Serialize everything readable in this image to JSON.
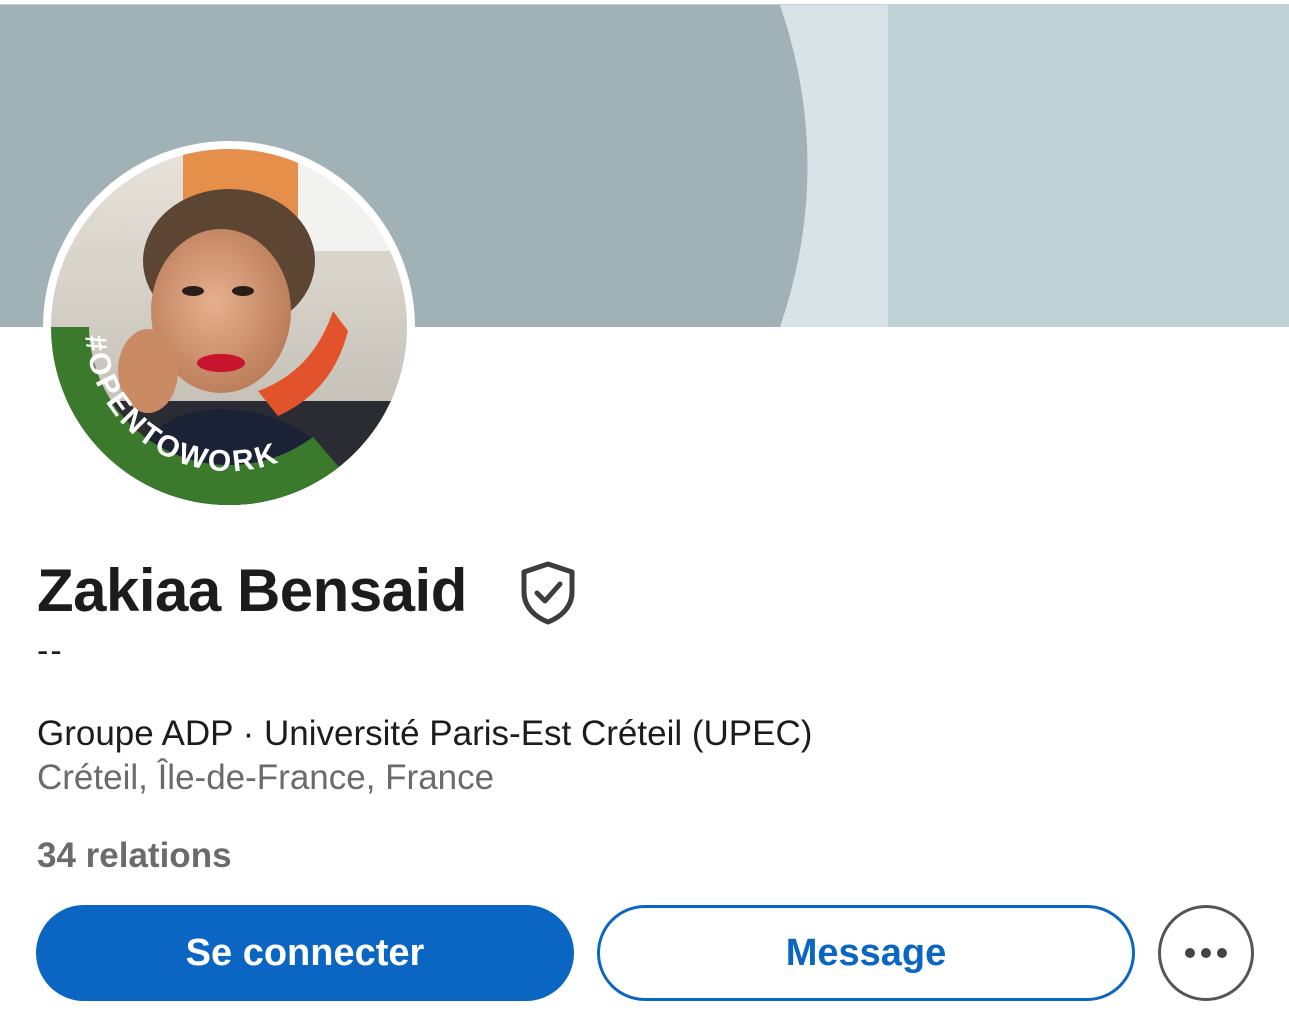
{
  "profile": {
    "name": "Zakiaa Bensaid",
    "headline": "--",
    "companies": "Groupe ADP · Université Paris-Est Créteil (UPEC)",
    "location": "Créteil, Île-de-France, France",
    "relations": "34 relations",
    "avatar_badge": "#OPENTOWORK"
  },
  "actions": {
    "connect_label": "Se connecter",
    "message_label": "Message",
    "more_icon": "more-horizontal-icon"
  },
  "icons": {
    "verified": "shield-check-icon"
  },
  "colors": {
    "primary": "#0a66c2",
    "open_to_work": "#3b7a2c",
    "cover_main": "#a0b2b5",
    "cover_light": "#d7e3e6",
    "cover_right": "#bfd2d6"
  }
}
